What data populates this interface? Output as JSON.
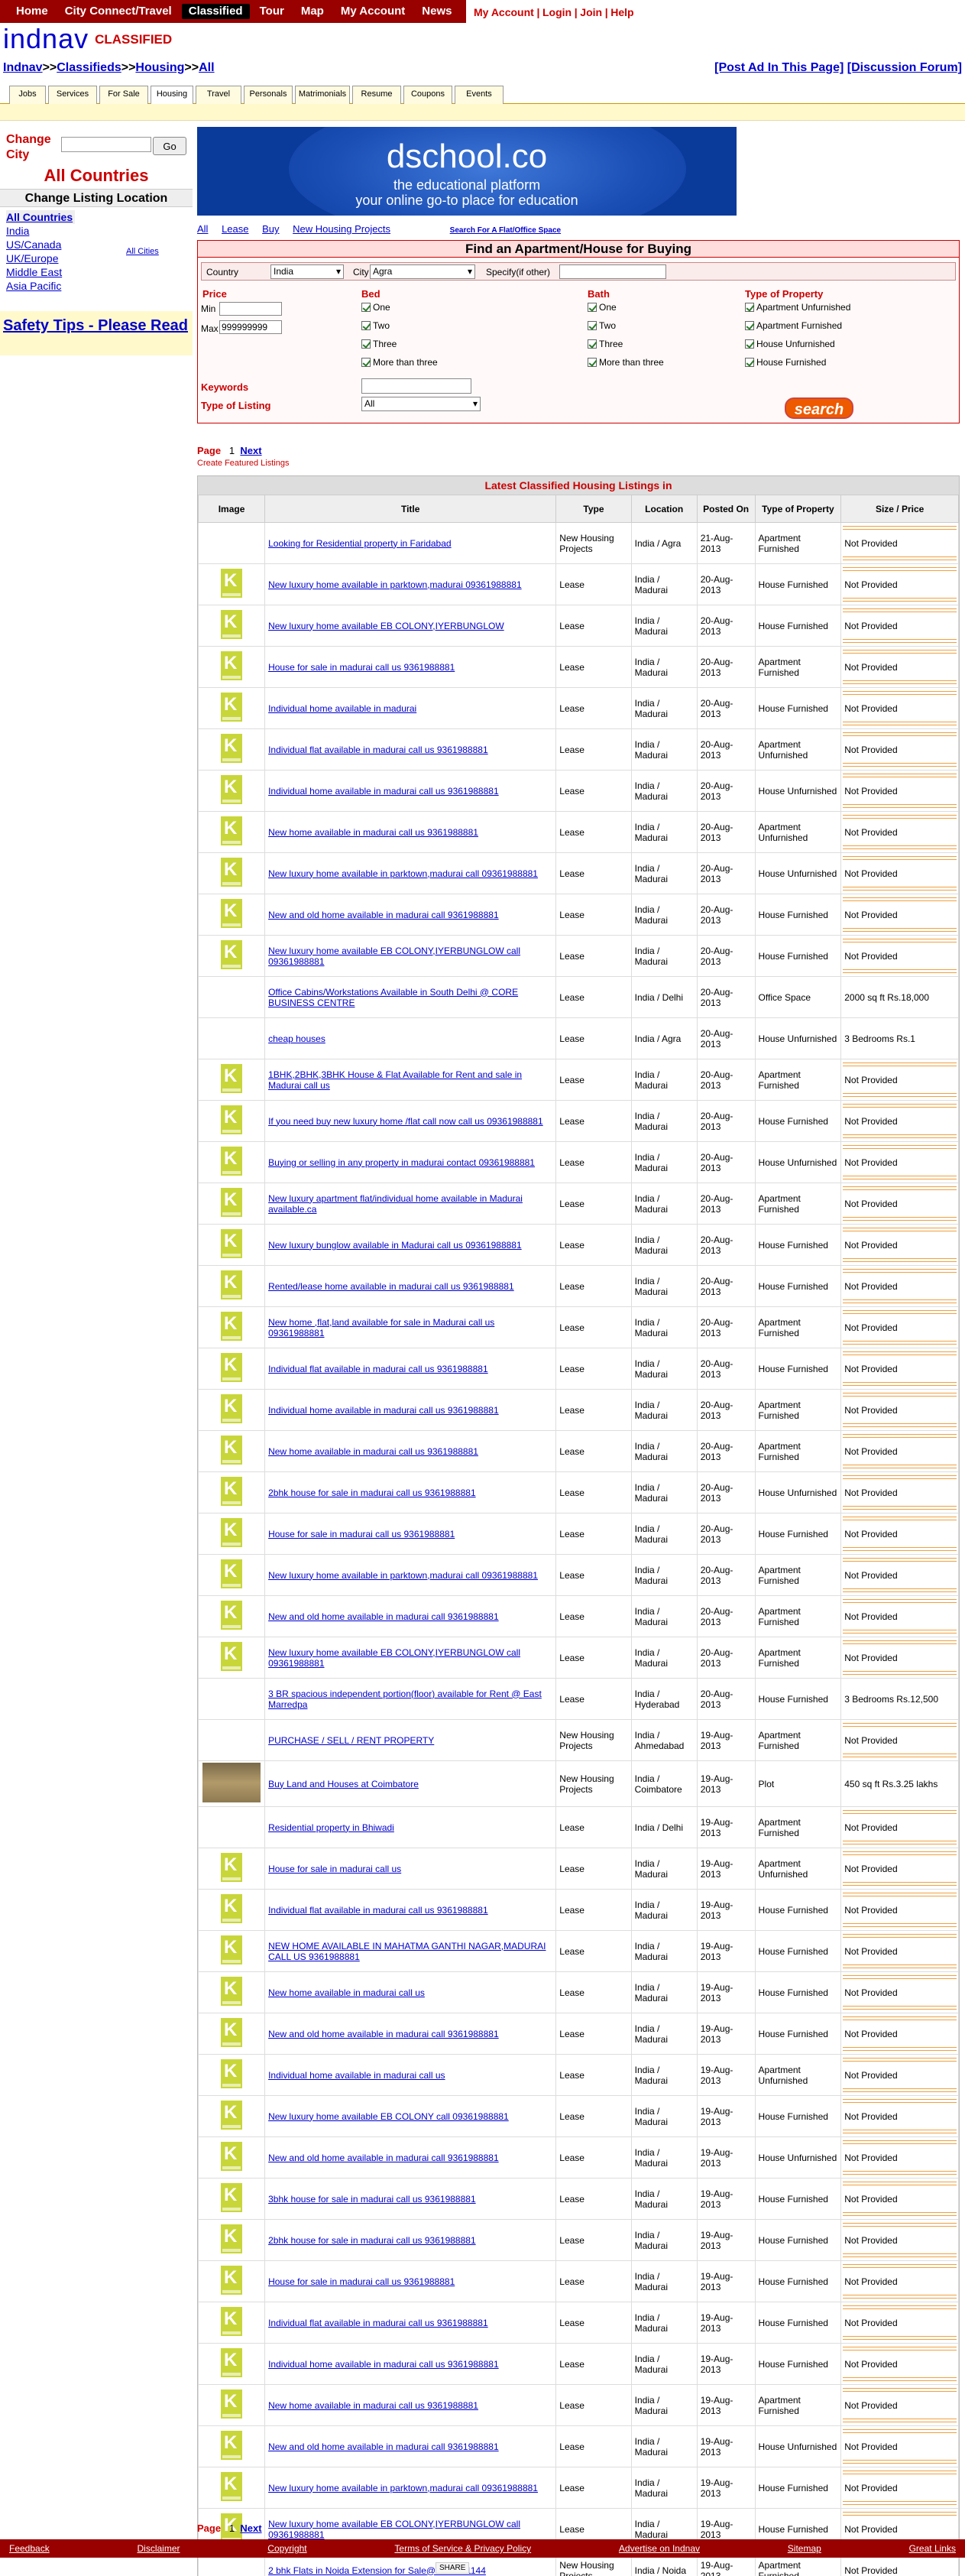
{
  "nav": {
    "items": [
      "Home",
      "City Connect/Travel",
      "Classified",
      "Tour",
      "Map",
      "My Account",
      "News"
    ],
    "selected": "Classified"
  },
  "account": {
    "my_account": "My Account",
    "login": "Login",
    "join": "Join",
    "help": "Help",
    "sep": "|"
  },
  "logo": {
    "brand": "indnav",
    "section": "CLASSIFIED"
  },
  "breadcrumb": {
    "items": [
      "Indnav",
      "Classifieds",
      "Housing",
      "All"
    ],
    "sep": ">>"
  },
  "post_links": {
    "post_ad": "[Post Ad In This Page]",
    "discussion": "[Discussion Forum]"
  },
  "tabs": [
    "Jobs",
    "Services",
    "For Sale",
    "Housing",
    "Travel",
    "Personals",
    "Matrimonials",
    "Resume",
    "Coupons",
    "Events"
  ],
  "tab_selected": "Housing",
  "sidebar": {
    "change_city_label": "Change City",
    "go_label": "Go",
    "all_countries": "All Countries",
    "change_location": "Change Listing Location",
    "countries": [
      "All Countries",
      "India",
      "US/Canada",
      "UK/Europe",
      "Middle East",
      "Asia Pacific"
    ],
    "all_cities": "All Cities",
    "safety": "Safety Tips - Please Read"
  },
  "banner": {
    "title": "dschool.co",
    "line1": "the educational platform",
    "line2": "your online go-to place for education"
  },
  "subnav": {
    "all": "All",
    "lease": "Lease",
    "buy": "Buy",
    "new_projects": "New Housing Projects",
    "flat_office": "Search For A Flat/Office Space"
  },
  "search": {
    "title": "Find an Apartment/House for Buying",
    "country_label": "Country",
    "country_value": "India",
    "city_label": "City",
    "city_value": "Agra",
    "specify_label": "Specify(if other)",
    "price_label": "Price",
    "min_label": "Min",
    "max_label": "Max",
    "max_value": "999999999",
    "bed_label": "Bed",
    "bath_label": "Bath",
    "property_label": "Type of Property",
    "bed_options": [
      "One",
      "Two",
      "Three",
      "More than three"
    ],
    "bath_options": [
      "One",
      "Two",
      "Three",
      "More than three"
    ],
    "property_options": [
      "Apartment Unfurnished",
      "Apartment Furnished",
      "House Unfurnished",
      "House Furnished"
    ],
    "keywords_label": "Keywords",
    "listing_type_label": "Type of Listing",
    "listing_type_value": "All",
    "search_button": "search"
  },
  "pager": {
    "page_label": "Page",
    "page": "1",
    "next": "Next",
    "featured": "Create Featured Listings"
  },
  "listings": {
    "caption": "Latest Classified Housing Listings in",
    "headers": [
      "Image",
      "Title",
      "Type",
      "Location",
      "Posted On",
      "Type of Property",
      "Size / Price"
    ],
    "rows": [
      {
        "img": "none",
        "title": "Looking for Residential property in Faridabad",
        "type": "New Housing Projects",
        "loc": "India / Agra",
        "date": "21-Aug-2013",
        "prop": "Apartment Furnished",
        "price": "Not Provided"
      },
      {
        "img": "k",
        "title": "New luxury home available in parktown,madurai 09361988881",
        "type": "Lease",
        "loc": "India / Madurai",
        "date": "20-Aug-2013",
        "prop": "House Furnished",
        "price": "Not Provided"
      },
      {
        "img": "k",
        "title": "New luxury home available EB COLONY,IYERBUNGLOW",
        "type": "Lease",
        "loc": "India / Madurai",
        "date": "20-Aug-2013",
        "prop": "House Furnished",
        "price": "Not Provided"
      },
      {
        "img": "k",
        "title": "House for sale in madurai call us 9361988881",
        "type": "Lease",
        "loc": "India / Madurai",
        "date": "20-Aug-2013",
        "prop": "Apartment Furnished",
        "price": "Not Provided"
      },
      {
        "img": "k",
        "title": "Individual home available in madurai",
        "type": "Lease",
        "loc": "India / Madurai",
        "date": "20-Aug-2013",
        "prop": "House Furnished",
        "price": "Not Provided"
      },
      {
        "img": "k",
        "title": "Individual flat available in madurai call us 9361988881",
        "type": "Lease",
        "loc": "India / Madurai",
        "date": "20-Aug-2013",
        "prop": "Apartment Unfurnished",
        "price": "Not Provided"
      },
      {
        "img": "k",
        "title": "Individual home available in madurai call us 9361988881",
        "type": "Lease",
        "loc": "India / Madurai",
        "date": "20-Aug-2013",
        "prop": "House Unfurnished",
        "price": "Not Provided"
      },
      {
        "img": "k",
        "title": "New home available in madurai call us 9361988881",
        "type": "Lease",
        "loc": "India / Madurai",
        "date": "20-Aug-2013",
        "prop": "Apartment Unfurnished",
        "price": "Not Provided"
      },
      {
        "img": "k",
        "title": "New luxury home available in parktown,madurai call 09361988881",
        "type": "Lease",
        "loc": "India / Madurai",
        "date": "20-Aug-2013",
        "prop": "House Unfurnished",
        "price": "Not Provided"
      },
      {
        "img": "k",
        "title": "New and old home available in madurai call 9361988881",
        "type": "Lease",
        "loc": "India / Madurai",
        "date": "20-Aug-2013",
        "prop": "House Furnished",
        "price": "Not Provided"
      },
      {
        "img": "k",
        "title": "New luxury home available EB COLONY,IYERBUNGLOW call 09361988881",
        "type": "Lease",
        "loc": "India / Madurai",
        "date": "20-Aug-2013",
        "prop": "House Furnished",
        "price": "Not Provided"
      },
      {
        "img": "none",
        "title": "Office Cabins/Workstations Available in South Delhi @ CORE BUSINESS CENTRE",
        "type": "Lease",
        "loc": "India / Delhi",
        "date": "20-Aug-2013",
        "prop": "Office Space",
        "price": "2000 sq ft    Rs.18,000"
      },
      {
        "img": "none",
        "title": "cheap houses",
        "type": "Lease",
        "loc": "India / Agra",
        "date": "20-Aug-2013",
        "prop": "House Unfurnished",
        "price": "3 Bedrooms    Rs.1"
      },
      {
        "img": "k",
        "title": "1BHK,2BHK,3BHK House & Flat Available for Rent and sale in Madurai call us",
        "type": "Lease",
        "loc": "India / Madurai",
        "date": "20-Aug-2013",
        "prop": "Apartment Furnished",
        "price": "Not Provided"
      },
      {
        "img": "k",
        "title": "If you need buy new luxury home /flat call now call us 09361988881",
        "type": "Lease",
        "loc": "India / Madurai",
        "date": "20-Aug-2013",
        "prop": "House Furnished",
        "price": "Not Provided"
      },
      {
        "img": "k",
        "title": "Buying or selling in any property in madurai contact 09361988881",
        "type": "Lease",
        "loc": "India / Madurai",
        "date": "20-Aug-2013",
        "prop": "House Unfurnished",
        "price": "Not Provided"
      },
      {
        "img": "k",
        "title": "New luxury apartment flat/individual home available in Madurai available.ca",
        "type": "Lease",
        "loc": "India / Madurai",
        "date": "20-Aug-2013",
        "prop": "Apartment Furnished",
        "price": "Not Provided"
      },
      {
        "img": "k",
        "title": "New luxury bunglow available in Madurai call us 09361988881",
        "type": "Lease",
        "loc": "India / Madurai",
        "date": "20-Aug-2013",
        "prop": "House Furnished",
        "price": "Not Provided"
      },
      {
        "img": "k",
        "title": "Rented/lease home available in madurai call us 9361988881",
        "type": "Lease",
        "loc": "India / Madurai",
        "date": "20-Aug-2013",
        "prop": "House Furnished",
        "price": "Not Provided"
      },
      {
        "img": "k",
        "title": "New home ,flat,land available for sale in Madurai call us 09361988881",
        "type": "Lease",
        "loc": "India / Madurai",
        "date": "20-Aug-2013",
        "prop": "Apartment Furnished",
        "price": "Not Provided"
      },
      {
        "img": "k",
        "title": "Individual flat available in madurai call us 9361988881",
        "type": "Lease",
        "loc": "India / Madurai",
        "date": "20-Aug-2013",
        "prop": "House Furnished",
        "price": "Not Provided"
      },
      {
        "img": "k",
        "title": "Individual home available in madurai call us 9361988881",
        "type": "Lease",
        "loc": "India / Madurai",
        "date": "20-Aug-2013",
        "prop": "Apartment Furnished",
        "price": "Not Provided"
      },
      {
        "img": "k",
        "title": "New home available in madurai call us 9361988881",
        "type": "Lease",
        "loc": "India / Madurai",
        "date": "20-Aug-2013",
        "prop": "Apartment Furnished",
        "price": "Not Provided"
      },
      {
        "img": "k",
        "title": "2bhk house for sale in madurai call us 9361988881",
        "type": "Lease",
        "loc": "India / Madurai",
        "date": "20-Aug-2013",
        "prop": "House Unfurnished",
        "price": "Not Provided"
      },
      {
        "img": "k",
        "title": "House for sale in madurai call us 9361988881",
        "type": "Lease",
        "loc": "India / Madurai",
        "date": "20-Aug-2013",
        "prop": "House Furnished",
        "price": "Not Provided"
      },
      {
        "img": "k",
        "title": "New luxury home available in parktown,madurai call 09361988881",
        "type": "Lease",
        "loc": "India / Madurai",
        "date": "20-Aug-2013",
        "prop": "Apartment Furnished",
        "price": "Not Provided"
      },
      {
        "img": "k",
        "title": "New and old home available in madurai call 9361988881",
        "type": "Lease",
        "loc": "India / Madurai",
        "date": "20-Aug-2013",
        "prop": "Apartment Furnished",
        "price": "Not Provided"
      },
      {
        "img": "k",
        "title": "New luxury home available EB COLONY,IYERBUNGLOW call 09361988881",
        "type": "Lease",
        "loc": "India / Madurai",
        "date": "20-Aug-2013",
        "prop": "Apartment Furnished",
        "price": "Not Provided"
      },
      {
        "img": "none",
        "title": "3 BR spacious independent portion(floor) available for Rent @ East Marredpa",
        "type": "Lease",
        "loc": "India / Hyderabad",
        "date": "20-Aug-2013",
        "prop": "House Furnished",
        "price": "3 Bedrooms    Rs.12,500"
      },
      {
        "img": "none",
        "title": "PURCHASE / SELL / RENT PROPERTY",
        "type": "New Housing Projects",
        "loc": "India / Ahmedabad",
        "date": "19-Aug-2013",
        "prop": "Apartment Furnished",
        "price": "Not Provided"
      },
      {
        "img": "land",
        "title": "Buy Land and Houses at Coimbatore",
        "type": "New Housing Projects",
        "loc": "India / Coimbatore",
        "date": "19-Aug-2013",
        "prop": "Plot",
        "price": "450 sq ft    Rs.3.25 lakhs"
      },
      {
        "img": "none",
        "title": "Residential property in Bhiwadi",
        "type": "Lease",
        "loc": "India / Delhi",
        "date": "19-Aug-2013",
        "prop": "Apartment Furnished",
        "price": "Not Provided"
      },
      {
        "img": "k",
        "title": "House for sale in madurai call us",
        "type": "Lease",
        "loc": "India / Madurai",
        "date": "19-Aug-2013",
        "prop": "Apartment Unfurnished",
        "price": "Not Provided"
      },
      {
        "img": "k",
        "title": "Individual flat available in madurai call us 9361988881",
        "type": "Lease",
        "loc": "India / Madurai",
        "date": "19-Aug-2013",
        "prop": "House Furnished",
        "price": "Not Provided"
      },
      {
        "img": "k",
        "title": "NEW HOME AVAILABLE IN MAHATMA GANTHI NAGAR,MADURAI CALL US 9361988881",
        "type": "Lease",
        "loc": "India / Madurai",
        "date": "19-Aug-2013",
        "prop": "House Furnished",
        "price": "Not Provided"
      },
      {
        "img": "k",
        "title": "New home available in madurai call us",
        "type": "Lease",
        "loc": "India / Madurai",
        "date": "19-Aug-2013",
        "prop": "House Furnished",
        "price": "Not Provided"
      },
      {
        "img": "k",
        "title": "New and old home available in madurai call 9361988881",
        "type": "Lease",
        "loc": "India / Madurai",
        "date": "19-Aug-2013",
        "prop": "House Furnished",
        "price": "Not Provided"
      },
      {
        "img": "k",
        "title": "Individual home available in madurai call us",
        "type": "Lease",
        "loc": "India / Madurai",
        "date": "19-Aug-2013",
        "prop": "Apartment Unfurnished",
        "price": "Not Provided"
      },
      {
        "img": "k",
        "title": "New luxury home available EB COLONY call 09361988881",
        "type": "Lease",
        "loc": "India / Madurai",
        "date": "19-Aug-2013",
        "prop": "House Furnished",
        "price": "Not Provided"
      },
      {
        "img": "k",
        "title": "New and old home available in madurai call 9361988881",
        "type": "Lease",
        "loc": "India / Madurai",
        "date": "19-Aug-2013",
        "prop": "House Unfurnished",
        "price": "Not Provided"
      },
      {
        "img": "k",
        "title": "3bhk house for sale in madurai call us 9361988881",
        "type": "Lease",
        "loc": "India / Madurai",
        "date": "19-Aug-2013",
        "prop": "House Furnished",
        "price": "Not Provided"
      },
      {
        "img": "k",
        "title": "2bhk house for sale in madurai call us 9361988881",
        "type": "Lease",
        "loc": "India / Madurai",
        "date": "19-Aug-2013",
        "prop": "House Furnished",
        "price": "Not Provided"
      },
      {
        "img": "k",
        "title": "House for sale in madurai call us 9361988881",
        "type": "Lease",
        "loc": "India / Madurai",
        "date": "19-Aug-2013",
        "prop": "House Furnished",
        "price": "Not Provided"
      },
      {
        "img": "k",
        "title": "Individual flat available in madurai call us 9361988881",
        "type": "Lease",
        "loc": "India / Madurai",
        "date": "19-Aug-2013",
        "prop": "House Furnished",
        "price": "Not Provided"
      },
      {
        "img": "k",
        "title": "Individual home available in madurai call us 9361988881",
        "type": "Lease",
        "loc": "India / Madurai",
        "date": "19-Aug-2013",
        "prop": "House Furnished",
        "price": "Not Provided"
      },
      {
        "img": "k",
        "title": "New home available in madurai call us 9361988881",
        "type": "Lease",
        "loc": "India / Madurai",
        "date": "19-Aug-2013",
        "prop": "Apartment Furnished",
        "price": "Not Provided"
      },
      {
        "img": "k",
        "title": "New and old home available in madurai call 9361988881",
        "type": "Lease",
        "loc": "India / Madurai",
        "date": "19-Aug-2013",
        "prop": "House Unfurnished",
        "price": "Not Provided"
      },
      {
        "img": "k",
        "title": "New luxury home available in parktown,madurai call 09361988881",
        "type": "Lease",
        "loc": "India / Madurai",
        "date": "19-Aug-2013",
        "prop": "House Furnished",
        "price": "Not Provided"
      },
      {
        "img": "k",
        "title": "New luxury home available EB COLONY,IYERBUNGLOW call 09361988881",
        "type": "Lease",
        "loc": "India / Madurai",
        "date": "19-Aug-2013",
        "prop": "House Furnished",
        "price": "Not Provided"
      },
      {
        "img": "none",
        "title": "2 bhk Flats in Noida Extension for Sale@9540901144",
        "type": "New Housing Projects",
        "loc": "India / Noida",
        "date": "19-Aug-2013",
        "prop": "Apartment Furnished",
        "price": "Not Provided"
      }
    ]
  },
  "footer": [
    "Feedback",
    "Disclaimer",
    "Copyright",
    "Terms of Service & Privacy Policy",
    "Advertise on Indnav",
    "Sitemap",
    "Great Links"
  ],
  "share": "SHARE"
}
